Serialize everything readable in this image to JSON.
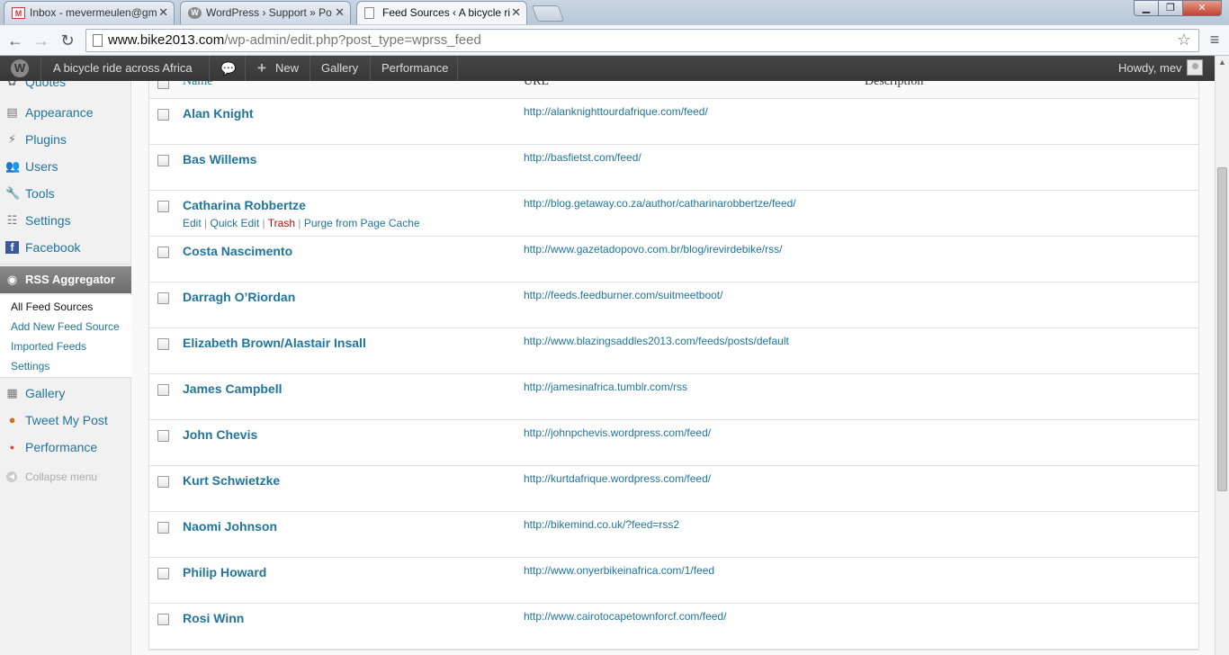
{
  "browser": {
    "tabs": [
      {
        "label": "Inbox - mevermeulen@gm",
        "icon": "gmail-icon"
      },
      {
        "label": "WordPress › Support » Po",
        "icon": "wordpress-icon"
      },
      {
        "label": "Feed Sources ‹ A bicycle ri",
        "icon": "page-icon"
      }
    ],
    "url_host": "www.bike2013.com",
    "url_path": "/wp-admin/edit.php?post_type=wprss_feed"
  },
  "adminbar": {
    "site_name": "A bicycle ride across Africa",
    "new_label": "New",
    "gallery_label": "Gallery",
    "performance_label": "Performance",
    "howdy": "Howdy, mev"
  },
  "menu": {
    "items": [
      {
        "label": "Quotes"
      },
      {
        "label": "Appearance"
      },
      {
        "label": "Plugins"
      },
      {
        "label": "Users"
      },
      {
        "label": "Tools"
      },
      {
        "label": "Settings"
      },
      {
        "label": "Facebook"
      },
      {
        "label": "RSS Aggregator"
      },
      {
        "label": "Gallery"
      },
      {
        "label": "Tweet My Post"
      },
      {
        "label": "Performance"
      }
    ],
    "submenu": [
      {
        "label": "All Feed Sources"
      },
      {
        "label": "Add New Feed Source"
      },
      {
        "label": "Imported Feeds"
      },
      {
        "label": "Settings"
      }
    ],
    "collapse_label": "Collapse menu"
  },
  "table": {
    "headers": {
      "name": "Name",
      "url": "URL",
      "description": "Description"
    },
    "rows": [
      {
        "name": "Alan Knight",
        "url": "http://alanknighttourdafrique.com/feed/"
      },
      {
        "name": "Bas Willems",
        "url": "http://basfietst.com/feed/"
      },
      {
        "name": "Catharina Robbertze",
        "url": "http://blog.getaway.co.za/author/catharinarobbertze/feed/"
      },
      {
        "name": "Costa Nascimento",
        "url": "http://www.gazetadopovo.com.br/blog/irevirdebike/rss/"
      },
      {
        "name": "Darragh O’Riordan",
        "url": "http://feeds.feedburner.com/suitmeetboot/"
      },
      {
        "name": "Elizabeth Brown/Alastair Insall",
        "url": "http://www.blazingsaddles2013.com/feeds/posts/default"
      },
      {
        "name": "James Campbell",
        "url": "http://jamesinafrica.tumblr.com/rss"
      },
      {
        "name": "John Chevis",
        "url": "http://johnpchevis.wordpress.com/feed/"
      },
      {
        "name": "Kurt Schwietzke",
        "url": "http://kurtdafrique.wordpress.com/feed/"
      },
      {
        "name": "Naomi Johnson",
        "url": "http://bikemind.co.uk/?feed=rss2"
      },
      {
        "name": "Philip Howard",
        "url": "http://www.onyerbikeinafrica.com/1/feed"
      },
      {
        "name": "Rosi Winn",
        "url": "http://www.cairotocapetownforcf.com/feed/"
      }
    ],
    "row_actions": {
      "edit": "Edit",
      "quick_edit": "Quick Edit",
      "trash": "Trash",
      "purge": "Purge from Page Cache",
      "separator": "|"
    }
  }
}
